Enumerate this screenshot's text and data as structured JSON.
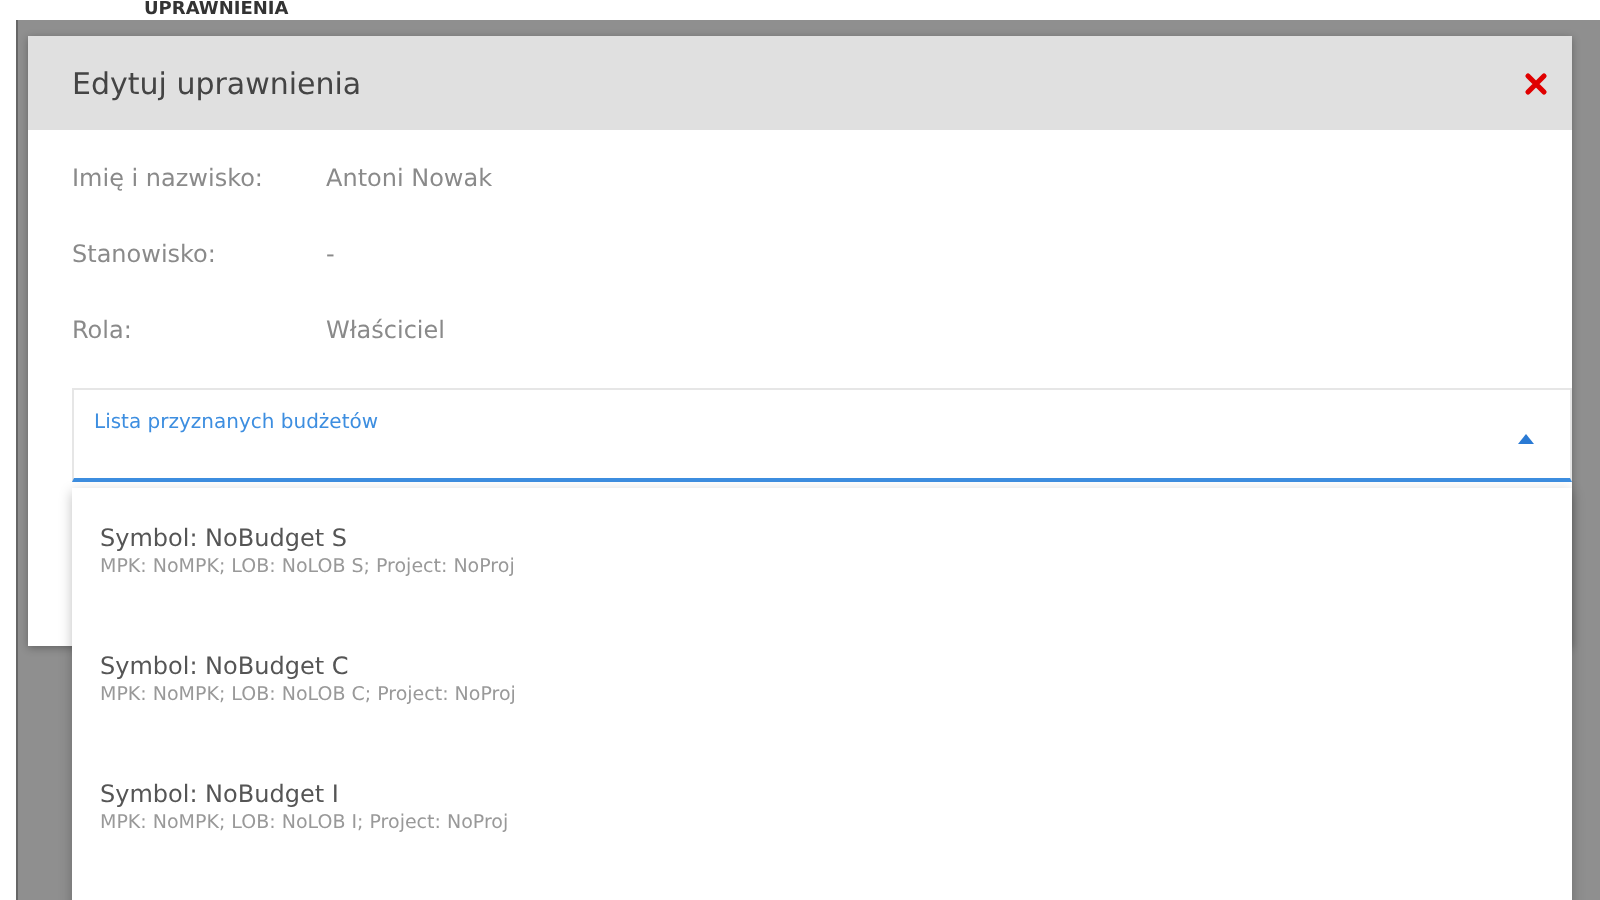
{
  "background": {
    "heading": "UPRAWNIENIA"
  },
  "dialog": {
    "title": "Edytuj uprawnienia",
    "fields": [
      {
        "label": "Imię i nazwisko:",
        "value": "Antoni Nowak"
      },
      {
        "label": "Stanowisko:",
        "value": "-"
      },
      {
        "label": "Rola:",
        "value": "Właściciel"
      }
    ],
    "budget_select": {
      "label": "Lista przyznanych budżetów",
      "expanded": true,
      "options": [
        {
          "title": "Symbol: NoBudget S",
          "details": "MPK: NoMPK; LOB: NoLOB S; Project: NoProj"
        },
        {
          "title": "Symbol: NoBudget C",
          "details": "MPK: NoMPK; LOB: NoLOB C; Project: NoProj"
        },
        {
          "title": "Symbol: NoBudget I",
          "details": "MPK: NoMPK; LOB: NoLOB I; Project: NoProj"
        }
      ]
    }
  }
}
